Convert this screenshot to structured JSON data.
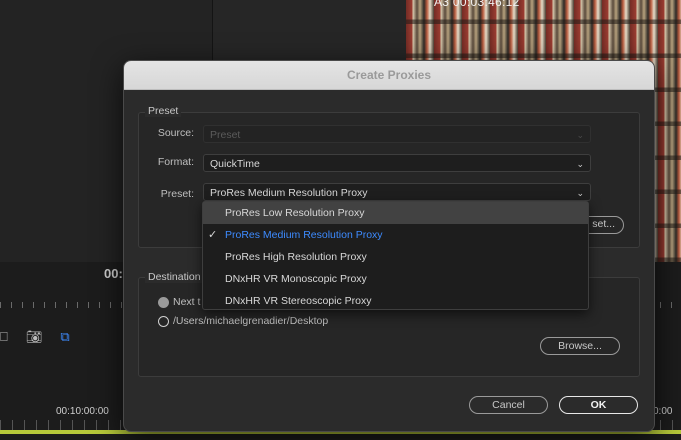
{
  "background": {
    "video_timecode": "A3 00:03:46:12",
    "left_timecode": "00:",
    "sequence_timecode": "00:10:00:00",
    "sequence_timecode_right": "0:00"
  },
  "dialog": {
    "title": "Create Proxies",
    "preset_group_label": "Preset",
    "source_label": "Source:",
    "source_value": "Preset",
    "format_label": "Format:",
    "format_value": "QuickTime",
    "preset_label": "Preset:",
    "preset_value": "ProRes Medium Resolution Proxy",
    "partial_button_label": "set...",
    "destination_group_label": "Destination",
    "option_next": "Next t",
    "option_path": "/Users/michaelgrenadier/Desktop",
    "browse_label": "Browse...",
    "cancel_label": "Cancel",
    "ok_label": "OK"
  },
  "dropdown": {
    "options": [
      "ProRes Low Resolution Proxy",
      "ProRes Medium Resolution Proxy",
      "ProRes High Resolution Proxy",
      "DNxHR VR Monoscopic Proxy",
      "DNxHR VR Stereoscopic Proxy"
    ],
    "selected_index": 1,
    "hover_index": 0
  },
  "colors": {
    "accent": "#3d8bff",
    "timeline_bar": "#b7c93a"
  }
}
